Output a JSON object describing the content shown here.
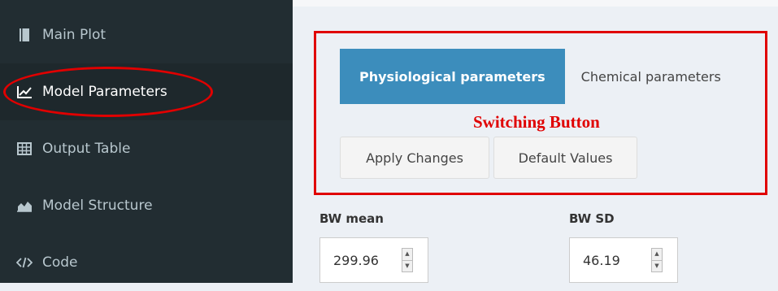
{
  "sidebar": {
    "items": [
      {
        "label": "Main Plot",
        "icon": "book-icon",
        "active": false
      },
      {
        "label": "Model Parameters",
        "icon": "line-chart-icon",
        "active": true
      },
      {
        "label": "Output Table",
        "icon": "table-icon",
        "active": false
      },
      {
        "label": "Model Structure",
        "icon": "area-chart-icon",
        "active": false
      },
      {
        "label": "Code",
        "icon": "code-icon",
        "active": false
      }
    ]
  },
  "tabs": [
    {
      "label": "Physiological parameters",
      "active": true
    },
    {
      "label": "Chemical parameters",
      "active": false
    }
  ],
  "buttons": {
    "apply": "Apply Changes",
    "default": "Default Values"
  },
  "annotation": {
    "text": "Switching Button",
    "color": "#e00000"
  },
  "fields": [
    {
      "label": "BW mean",
      "value": "299.96"
    },
    {
      "label": "BW SD",
      "value": "46.19"
    }
  ],
  "colors": {
    "sidebar_bg": "#222d32",
    "active_tab": "#3c8dbc",
    "content_bg": "#ecf0f5"
  }
}
